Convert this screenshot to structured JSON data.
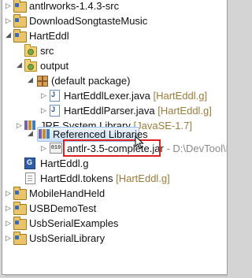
{
  "tree": {
    "antlrworks": {
      "label": "antlrworks-1.4.3-src"
    },
    "downloadsongtaste": {
      "label": "DownloadSongtasteMusic"
    },
    "harteddl": {
      "label": "HartEddl"
    },
    "src": {
      "label": "src"
    },
    "output": {
      "label": "output"
    },
    "default_package": {
      "label": "(default package)"
    },
    "lexer": {
      "label": "HartEddlLexer.java",
      "decoration": "[HartEddl.g]"
    },
    "parser": {
      "label": "HartEddlParser.java",
      "decoration": "[HartEddl.g]"
    },
    "jre": {
      "label": "JRE System Library",
      "decoration": "[JavaSE-1.7]"
    },
    "referenced": {
      "label": "Referenced Libraries"
    },
    "antlr_jar": {
      "label": "antlr-3.5-complete.jar",
      "decoration": "- D:\\DevTool\\D"
    },
    "grammar": {
      "label": "HartEddl.g"
    },
    "tokens": {
      "label": "HartEddl.tokens",
      "decoration": "[HartEddl.g]"
    },
    "mobile": {
      "label": "MobileHandHeld"
    },
    "usbdemo": {
      "label": "USBDemoTest"
    },
    "usbexamples": {
      "label": "UsbSerialExamples"
    },
    "usblibrary": {
      "label": "UsbSerialLibrary"
    }
  },
  "icons": {
    "collapsed": "▷",
    "expanded": "◢",
    "jar_text": "010"
  },
  "colors": {
    "decoration": "#9c7c3a",
    "highlight_box": "#e0201f",
    "selection": "#cfe2f6"
  }
}
